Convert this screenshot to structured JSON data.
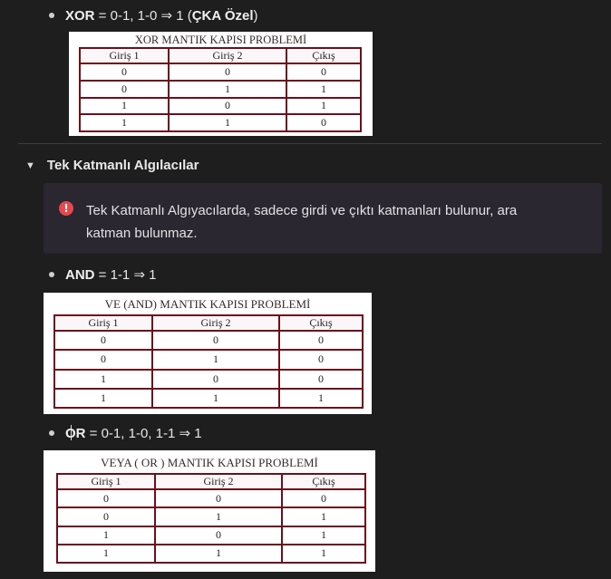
{
  "blocks": {
    "xor": {
      "bold": "XOR",
      "rest": " = 0-1, 1-0 ⇒ 1 (",
      "bold2": "ÇKA Özel",
      "rest2": ")",
      "table_title": "XOR   MANTIK KAPISI PROBLEMİ",
      "headers": [
        "Giriş 1",
        "Giriş 2",
        "Çıkış"
      ],
      "rows": [
        [
          "0",
          "0",
          "0"
        ],
        [
          "0",
          "1",
          "1"
        ],
        [
          "1",
          "0",
          "1"
        ],
        [
          "1",
          "1",
          "0"
        ]
      ]
    },
    "section": {
      "toggle_title": "Tek Katmanlı Algılacılar",
      "callout_icon": "!",
      "callout_text": "Tek Katmanlı Algıyacılarda, sadece girdi ve çıktı katmanları bulunur, ara katman bulunmaz."
    },
    "and": {
      "bold": "AND",
      "rest": " = 1-1 ⇒ 1",
      "table_title": "VE (AND) MANTIK KAPISI PROBLEMİ",
      "headers": [
        "Giriş 1",
        "Giriş 2",
        "Çıkış"
      ],
      "rows": [
        [
          "0",
          "0",
          "0"
        ],
        [
          "0",
          "1",
          "0"
        ],
        [
          "1",
          "0",
          "0"
        ],
        [
          "1",
          "1",
          "1"
        ]
      ]
    },
    "or": {
      "bold": "OR",
      "rest": " = 0-1, 1-0, 1-1 ⇒ 1",
      "table_title": "VEYA  ( OR )  MANTIK KAPISI PROBLEMİ",
      "headers": [
        "Giriş 1",
        "Giriş 2",
        "Çıkış"
      ],
      "rows": [
        [
          "0",
          "0",
          "0"
        ],
        [
          "0",
          "1",
          "1"
        ],
        [
          "1",
          "0",
          "1"
        ],
        [
          "1",
          "1",
          "1"
        ]
      ]
    }
  },
  "colors": {
    "background": "#1e1e1e",
    "callout_bg": "#2a2730",
    "callout_icon": "#e5484d",
    "table_border": "#6b0f1e"
  },
  "icons": {
    "toggle": "triangle-down-icon",
    "callout": "exclamation-circle-icon"
  }
}
